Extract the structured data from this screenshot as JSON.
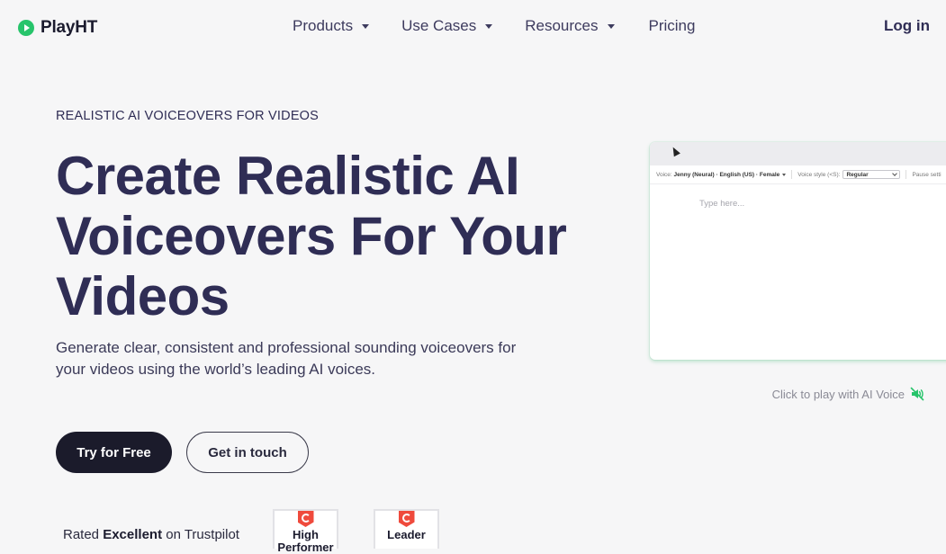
{
  "header": {
    "logo_text": "PlayHT",
    "nav": [
      {
        "label": "Products"
      },
      {
        "label": "Use Cases"
      },
      {
        "label": "Resources"
      },
      {
        "label": "Pricing"
      }
    ],
    "login_label": "Log in"
  },
  "hero": {
    "eyebrow": "REALISTIC AI VOICEOVERS FOR VIDEOS",
    "headline": "Create Realistic AI Voiceovers For Your Videos",
    "subtitle": "Generate clear, consistent and professional sounding voiceovers for your videos using the world’s leading AI voices.",
    "primary_cta": "Try for Free",
    "secondary_cta": "Get in touch",
    "rating_prefix": "Rated",
    "rating_bold": "Excellent",
    "rating_suffix": "on Trustpilot",
    "badges": [
      {
        "label": "High Performer"
      },
      {
        "label": "Leader"
      }
    ]
  },
  "editor": {
    "voice_label": "Voice:",
    "voice_value": "Jenny (Neural) · English (US) · Female",
    "style_label": "Voice style (<S):",
    "style_value": "Regular",
    "pause_label": "Pause setti",
    "placeholder": "Type here...",
    "play_hint": "Click to play with AI Voice"
  },
  "colors": {
    "brand_green": "#27c46b",
    "heading": "#2f2d55",
    "primary_button": "#1b1b2b",
    "background": "#f6f6f7"
  },
  "icons": {
    "logo": "play-circle-icon",
    "nav_caret": "caret-down-icon",
    "play_hint": "speaker-mute-icon",
    "badge": "g2-logo-icon"
  }
}
